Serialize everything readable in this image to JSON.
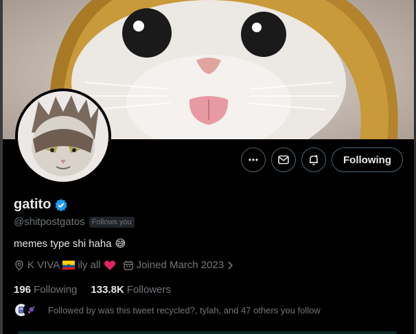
{
  "profile": {
    "display_name": "gatito",
    "handle": "@shitpostgatos",
    "follows_you": "Follows you",
    "bio": "memes type shi haha",
    "bio_emoji": "😅",
    "location": "K VIVA",
    "location_suffix": "ily all",
    "joined": "Joined March 2023"
  },
  "stats": {
    "following_count": "196",
    "following_label": "Following",
    "followers_count": "133.8K",
    "followers_label": "Followers"
  },
  "followed_by": "Followed by was this tweet recycled?, tylah, and 47 others you follow",
  "actions": {
    "follow_label": "Following"
  },
  "colors": {
    "verified": "#1d9bf0",
    "heart": "#e0245e",
    "border": "#536471",
    "secondary_text": "#71767b"
  },
  "icons": [
    "more-icon",
    "envelope-icon",
    "notification-bell-icon",
    "verified-badge-icon",
    "location-pin-icon",
    "calendar-icon",
    "chevron-right-icon",
    "heart-icon",
    "ecuador-flag-icon"
  ]
}
